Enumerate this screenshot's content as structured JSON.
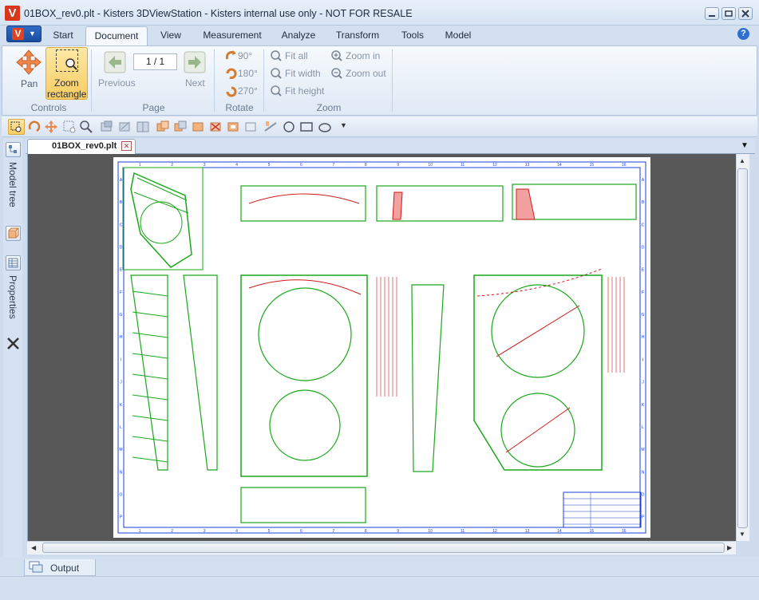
{
  "window": {
    "title": "01BOX_rev0.plt - Kisters 3DViewStation - Kisters internal use only - NOT FOR RESALE",
    "logo_letter": "V",
    "controls": [
      "minimize",
      "restore",
      "close"
    ]
  },
  "app_menu": {
    "letter": "V"
  },
  "tabs": [
    {
      "label": "Start",
      "active": false
    },
    {
      "label": "Document",
      "active": true
    },
    {
      "label": "View",
      "active": false
    },
    {
      "label": "Measurement",
      "active": false
    },
    {
      "label": "Analyze",
      "active": false
    },
    {
      "label": "Transform",
      "active": false
    },
    {
      "label": "Tools",
      "active": false
    },
    {
      "label": "Model",
      "active": false
    }
  ],
  "ribbon": {
    "controls": {
      "group_label": "Controls",
      "pan_label": "Pan",
      "zoom_rect_label_1": "Zoom",
      "zoom_rect_label_2": "rectangle"
    },
    "page": {
      "group_label": "Page",
      "previous_label": "Previous",
      "next_label": "Next",
      "page_value": "1 / 1"
    },
    "rotate": {
      "group_label": "Rotate",
      "r90": "90°",
      "r180": "180°",
      "r270": "270°"
    },
    "zoom": {
      "group_label": "Zoom",
      "fit_all": "Fit all",
      "fit_width": "Fit width",
      "fit_height": "Fit height",
      "zoom_in": "Zoom in",
      "zoom_out": "Zoom out"
    }
  },
  "side_panel": {
    "model_tree": "Model tree",
    "properties": "Properties"
  },
  "document_tab": {
    "label": "01BOX_rev0.plt"
  },
  "drawing": {
    "border_numbers": [
      "1",
      "2",
      "3",
      "4",
      "5",
      "6",
      "7",
      "8",
      "9",
      "10",
      "11",
      "12",
      "13",
      "14",
      "15",
      "16"
    ],
    "border_letters": [
      "A",
      "B",
      "C",
      "D",
      "E",
      "F",
      "G",
      "H",
      "I",
      "J",
      "K",
      "L",
      "M",
      "N",
      "O",
      "P"
    ]
  },
  "output": {
    "label": "Output"
  },
  "colors": {
    "accent_blue": "#2f6bc8",
    "logo_red": "#d9361c",
    "cad_green": "#1aa81a",
    "cad_red": "#d01818",
    "cad_blue": "#1a3fd6",
    "viewport_gray": "#585858"
  }
}
